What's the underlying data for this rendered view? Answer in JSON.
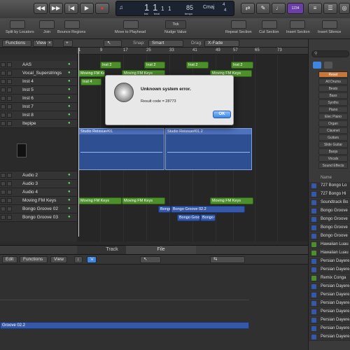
{
  "toolbar": {
    "lcd": {
      "bar": "1",
      "beat": "1",
      "tempo": "85",
      "key": "Cmaj",
      "sig_top": "4",
      "sig_bottom": "4",
      "bar_sub": "1",
      "beat_sub": "1",
      "bar_label": "bar",
      "beat_label": "beat",
      "tempo_label": "tempo"
    },
    "cpu_badge": "1234",
    "transport_icons": [
      "rewind-icon",
      "fast-forward-icon",
      "go-to-start-icon",
      "play-icon",
      "record-icon"
    ]
  },
  "tool_row": {
    "items": [
      "Split by Locators",
      "Join",
      "Bounce Regions",
      "Move to Playhead",
      "Nudge Value",
      "Repeat Section",
      "Cut Section",
      "Insert Section",
      "Insert Silence"
    ],
    "nudge_value": "Tick"
  },
  "arrange_menu": {
    "functions": "Functions",
    "view": "View",
    "snap_label": "Snap:",
    "snap_value": "Smart",
    "drag_label": "Drag:",
    "drag_value": "X-Fade"
  },
  "ruler": [
    "1",
    "9",
    "17",
    "25",
    "33",
    "41",
    "49",
    "57",
    "65",
    "73"
  ],
  "tracks": [
    {
      "name": "AAS"
    },
    {
      "name": "Vocal_Superstrings"
    },
    {
      "name": "Inst 4"
    },
    {
      "name": "Inst 5"
    },
    {
      "name": "Inst 6"
    },
    {
      "name": "Inst 7"
    },
    {
      "name": "Inst 8"
    },
    {
      "name": "Itepipe"
    },
    {
      "name": "Audio 2"
    },
    {
      "name": "Audio 3"
    },
    {
      "name": "Audio 4"
    },
    {
      "name": "Moving FM Keys"
    },
    {
      "name": "Bongo Groove 02"
    },
    {
      "name": "Bongo Groove 03"
    }
  ],
  "regions": {
    "inst2_a": "Inst 2",
    "inst2_b": "Inst 2",
    "inst2_c": "Inst 2",
    "inst2_d": "Inst 2",
    "mfk_a": "Moving FM Keys",
    "mfk_b": "Moving FM Keys",
    "mfk_c": "Moving FM Keys",
    "inst4": "Inst 4",
    "studio1": "Studio Reissue#01",
    "studio2": "Studio Reissue#01.2",
    "mfk_low_a": "Moving FM Keys",
    "mfk_low_b": "Moving FM Keys",
    "mfk_low_c": "Moving FM Keys",
    "bongo_a": "Bongo",
    "bongo_b": "Bongo Groove 02.2",
    "bongo_c": "Bongo Groove 02",
    "bongo_d": "Bongo G"
  },
  "dialog": {
    "title": "Unknown system error.",
    "message": "Result code = 28773",
    "ok_label": "OK"
  },
  "sidebar": {
    "categories": [
      "Reset",
      "All Drums",
      "Beats",
      "Bass",
      "Synths",
      "Piano",
      "Elec Piano",
      "Organ",
      "Clavinet",
      "Guitars",
      "Slide Guitar",
      "Banjo",
      "Vocals",
      "Sound Effects"
    ],
    "name_header": "Name",
    "loops": [
      {
        "name": "727 Bongo Lo",
        "type": "audio"
      },
      {
        "name": "727 Bongo Hi",
        "type": "audio"
      },
      {
        "name": "Soundtrack Bo",
        "type": "audio"
      },
      {
        "name": "Bongo Groove",
        "type": "audio"
      },
      {
        "name": "Bongo Groove",
        "type": "audio"
      },
      {
        "name": "Bongo Groove",
        "type": "audio"
      },
      {
        "name": "Bongo Groove",
        "type": "audio"
      },
      {
        "name": "Hawaiian Luau",
        "type": "midi"
      },
      {
        "name": "Hawaiian Luau",
        "type": "midi"
      },
      {
        "name": "Persian Dayere",
        "type": "audio"
      },
      {
        "name": "Persian Dayere",
        "type": "audio"
      },
      {
        "name": "Remix Conga",
        "type": "midi"
      },
      {
        "name": "Persian Dayere",
        "type": "audio"
      },
      {
        "name": "Persian Dayere",
        "type": "audio"
      },
      {
        "name": "Persian Dayere",
        "type": "audio"
      },
      {
        "name": "Persian Dayere",
        "type": "audio"
      },
      {
        "name": "Persian Dayere",
        "type": "audio"
      },
      {
        "name": "Persian Dayere",
        "type": "audio"
      },
      {
        "name": "Persian Dayere",
        "type": "audio"
      }
    ]
  },
  "bottom_tabs": {
    "track": "Track",
    "file": "File"
  },
  "editor_menu": {
    "edit": "Edit",
    "functions": "Functions",
    "view": "View"
  },
  "editor_region": "Groove 02.2",
  "colors": {
    "midi_region": "#4d8f2a",
    "audio_region": "#3558a8",
    "accent": "#3d86e6"
  }
}
